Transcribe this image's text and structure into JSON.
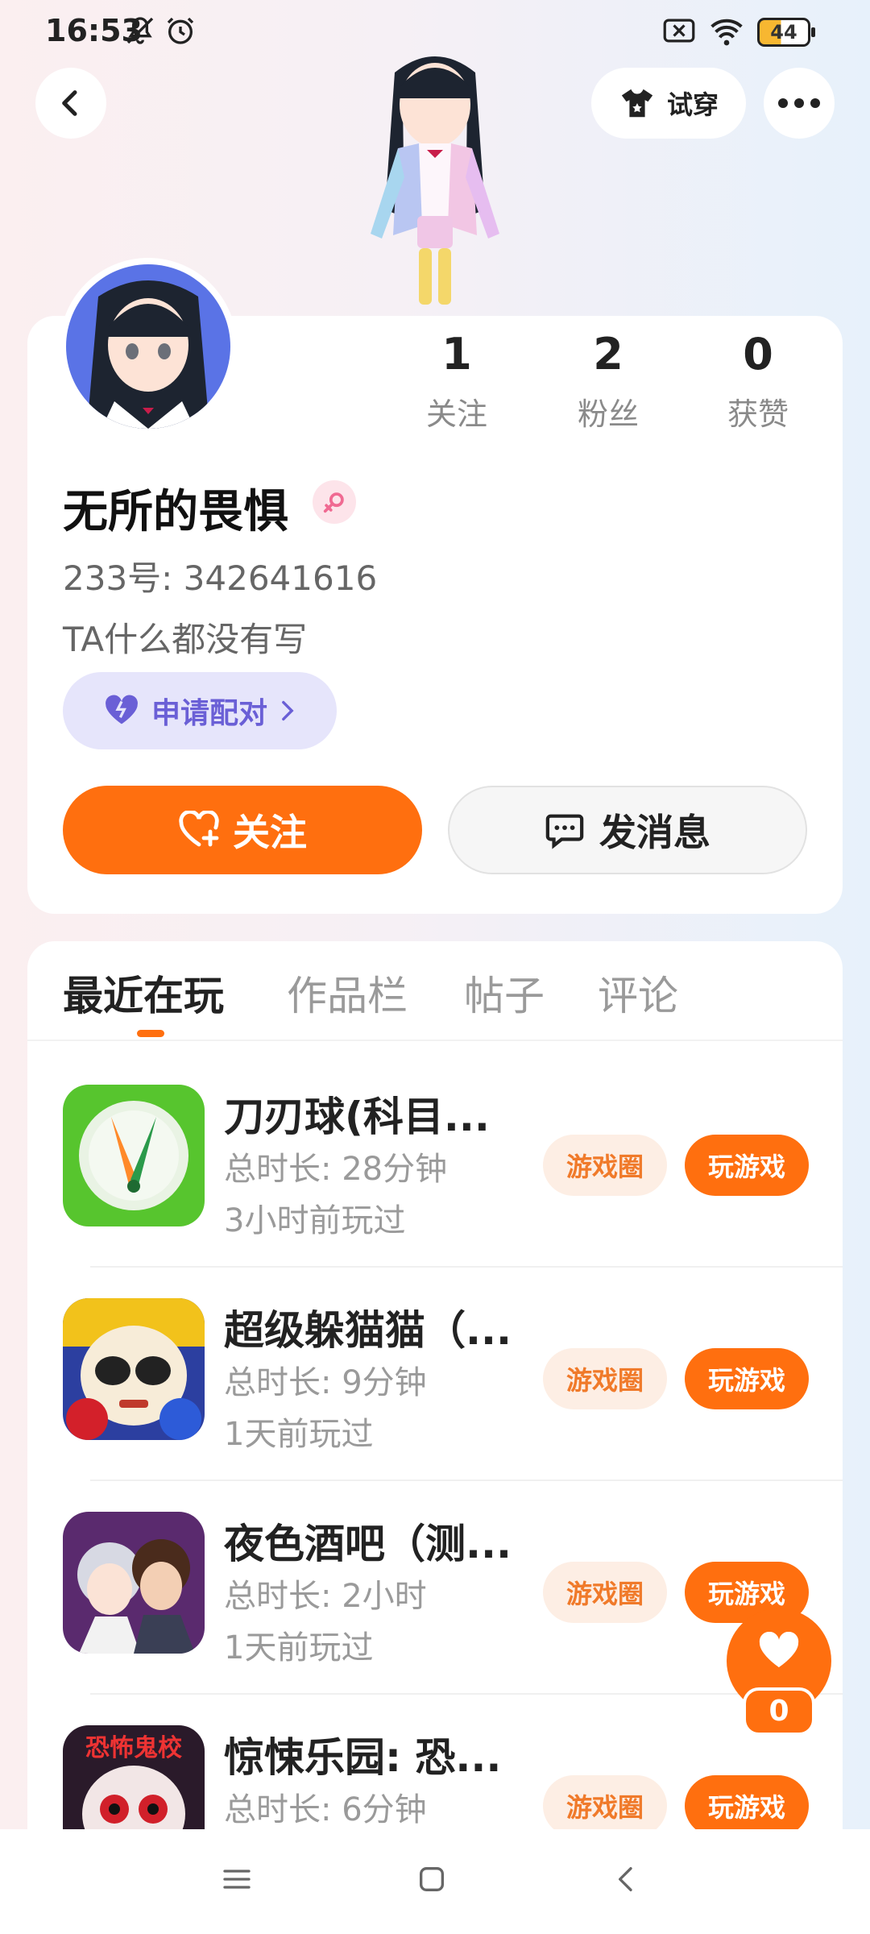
{
  "status_bar": {
    "time": "16:53",
    "icons": [
      "mute-icon",
      "alarm-icon",
      "no-sim-icon",
      "wifi-icon"
    ],
    "battery": "44"
  },
  "header": {
    "try_on_label": "试穿",
    "more_icon": "more-dots-icon",
    "back_icon": "back-arrow-icon"
  },
  "profile": {
    "stats": [
      {
        "value": "1",
        "label": "关注"
      },
      {
        "value": "2",
        "label": "粉丝"
      },
      {
        "value": "0",
        "label": "获赞"
      }
    ],
    "name": "无所的畏惧",
    "gender_icon": "female-icon",
    "id_line": "233号: 342641616",
    "bio": "TA什么都没有写",
    "pair_label": "申请配对",
    "follow_label": "关注",
    "message_label": "发消息"
  },
  "tabs": [
    {
      "label": "最近在玩",
      "active": true
    },
    {
      "label": "作品栏",
      "active": false
    },
    {
      "label": "帖子",
      "active": false
    },
    {
      "label": "评论",
      "active": false
    }
  ],
  "games": [
    {
      "name": "刀刃球(科目...",
      "duration": "总时长: 28分钟",
      "last_played": "3小时前玩过",
      "circle_label": "游戏圈",
      "play_label": "玩游戏"
    },
    {
      "name": "超级躲猫猫（...",
      "duration": "总时长: 9分钟",
      "last_played": "1天前玩过",
      "circle_label": "游戏圈",
      "play_label": "玩游戏"
    },
    {
      "name": "夜色酒吧（测...",
      "duration": "总时长: 2小时",
      "last_played": "1天前玩过",
      "circle_label": "游戏圈",
      "play_label": "玩游戏"
    },
    {
      "name": "惊悚乐园: 恐...",
      "duration": "总时长: 6分钟",
      "last_played": "",
      "circle_label": "游戏圈",
      "play_label": "玩游戏",
      "icon_text": "恐怖鬼校"
    }
  ],
  "like_float": {
    "count": "0"
  },
  "colors": {
    "accent": "#ff6f0f",
    "pair_bg": "#e6e5fb",
    "pair_text": "#6a5fd6"
  }
}
